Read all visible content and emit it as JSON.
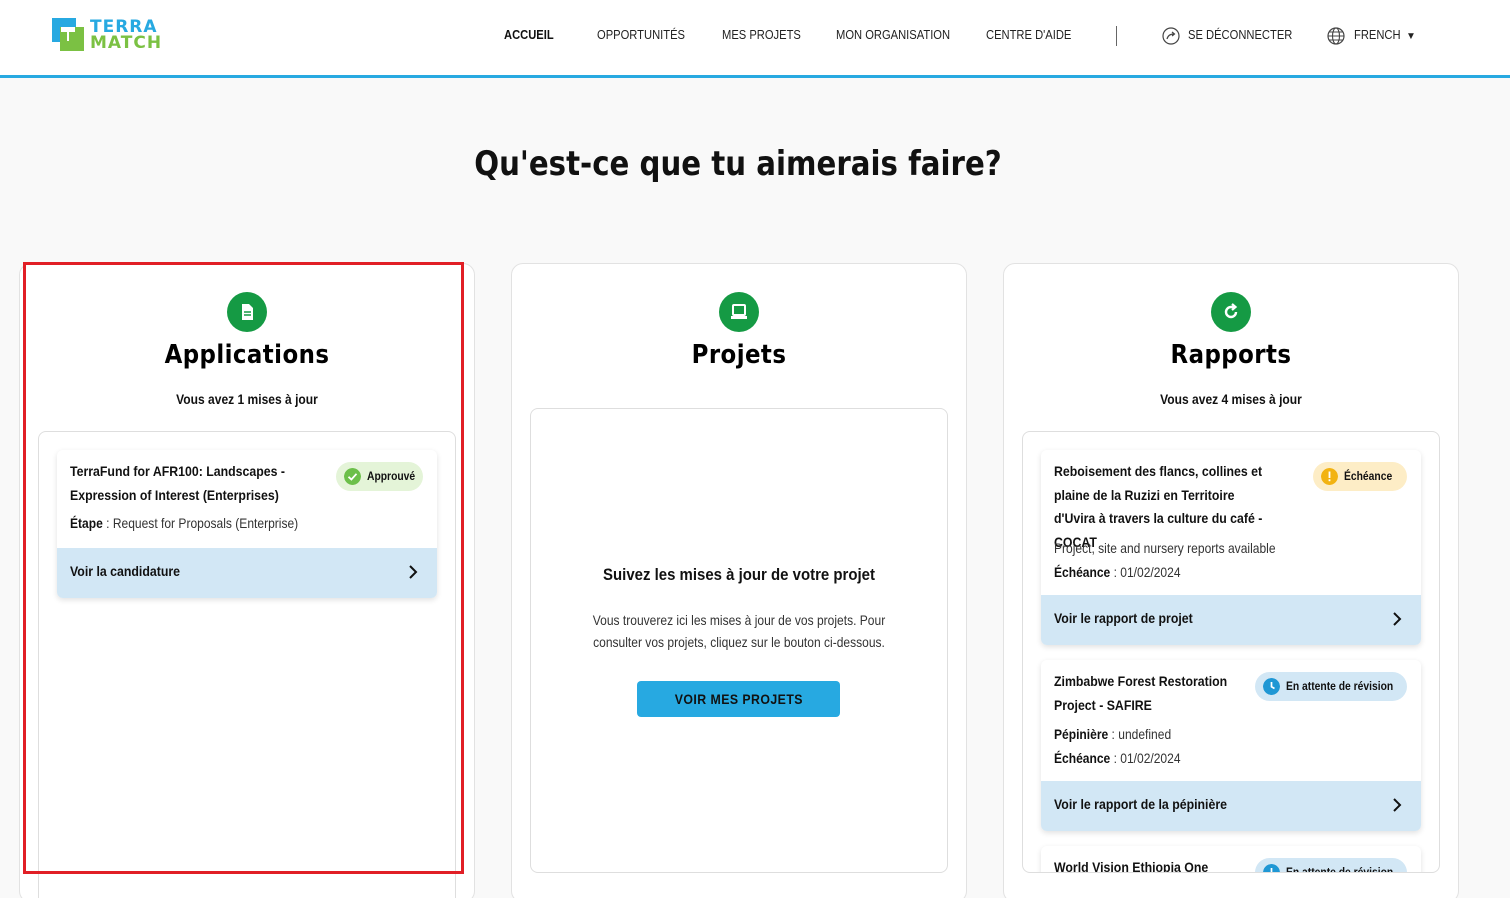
{
  "header": {
    "logo_line1": "TERRA",
    "logo_line2": "MATCH",
    "nav": {
      "home": "ACCUEIL",
      "opportunities": "OPPORTUNITÉS",
      "my_projects": "MES PROJETS",
      "my_organisation": "MON ORGANISATION",
      "help_center": "CENTRE D'AIDE",
      "logout": "SE DÉCONNECTER",
      "language": "FRENCH"
    }
  },
  "page_title": "Qu'est-ce que tu aimerais faire?",
  "applications": {
    "title": "Applications",
    "subtitle": "Vous avez 1 mises à jour",
    "item": {
      "title": "TerraFund for AFR100: Landscapes - Expression of Interest (Enterprises)",
      "badge": "Approuvé",
      "stage_label": "Étape",
      "stage_value": "Request for Proposals (Enterprise)",
      "action": "Voir la candidature"
    }
  },
  "projects": {
    "title": "Projets",
    "box_title": "Suivez les mises à jour de votre projet",
    "box_text": "Vous trouverez ici les mises à jour de vos projets. Pour consulter vos projets, cliquez sur le bouton ci-dessous.",
    "button": "VOIR MES PROJETS"
  },
  "reports": {
    "title": "Rapports",
    "subtitle": "Vous avez 4 mises à jour",
    "items": [
      {
        "title": "Reboisement des flancs, collines et plaine de la Ruzizi en Territoire d'Uvira à travers la culture du café - COCAT",
        "badge": "Échéance",
        "line1": "Project, site and nursery reports available",
        "due_label": "Échéance",
        "due_value": "01/02/2024",
        "action": "Voir le rapport de projet"
      },
      {
        "title": "Zimbabwe Forest Restoration Project - SAFIRE",
        "badge": "En attente de révision",
        "nursery_label": "Pépinière",
        "nursery_value": "undefined",
        "due_label": "Échéance",
        "due_value": "01/02/2024",
        "action": "Voir le rapport de la pépinière"
      },
      {
        "title": "World Vision Ethiopia One Tree",
        "badge": "En attente de révision"
      }
    ]
  },
  "colors": {
    "accent_blue": "#27a9e1",
    "brand_green": "#7bc143",
    "icon_green": "#159a44",
    "approved_badge_bg": "#e4f4d8",
    "due_badge_bg": "#fdedc6",
    "pending_badge_bg": "#d2e7f5",
    "action_bg": "#d2e7f5",
    "highlight_red": "#e11f26"
  }
}
